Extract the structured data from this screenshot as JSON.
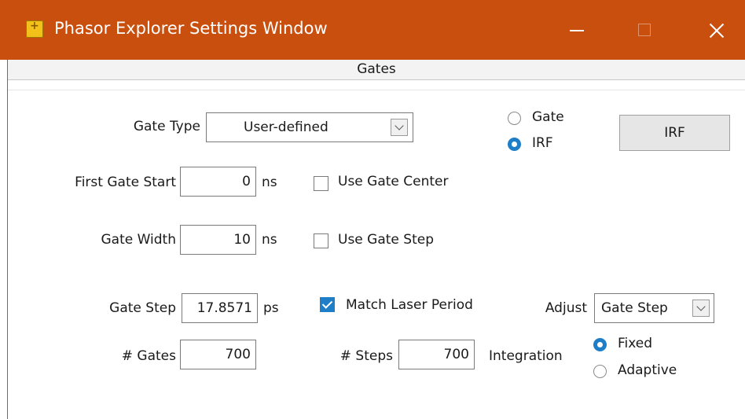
{
  "window": {
    "title": "Phasor Explorer Settings Window",
    "accent_color": "#c94f0f",
    "controls": [
      "minimize-icon",
      "maximize-icon",
      "close-icon"
    ]
  },
  "tabs": [
    {
      "label": "Gates",
      "active": true
    }
  ],
  "gate_type": {
    "label": "Gate Type",
    "value": "User-defined"
  },
  "mode": {
    "options": [
      {
        "label": "Gate",
        "selected": false
      },
      {
        "label": "IRF",
        "selected": true
      }
    ],
    "button_label": "IRF"
  },
  "first_gate_start": {
    "label": "First Gate Start",
    "value": "0",
    "unit": "ns"
  },
  "use_gate_center": {
    "label": "Use Gate Center",
    "checked": false
  },
  "gate_width": {
    "label": "Gate Width",
    "value": "10",
    "unit": "ns"
  },
  "use_gate_step": {
    "label": "Use Gate Step",
    "checked": false
  },
  "gate_step": {
    "label": "Gate Step",
    "value": "17.8571",
    "unit": "ps"
  },
  "match_laser_period": {
    "label": "Match Laser Period",
    "checked": true
  },
  "adjust": {
    "label": "Adjust",
    "value": "Gate Step"
  },
  "num_gates": {
    "label": "# Gates",
    "value": "700"
  },
  "num_steps": {
    "label": "# Steps",
    "value": "700"
  },
  "integration": {
    "label": "Integration",
    "options": [
      {
        "label": "Fixed",
        "selected": true
      },
      {
        "label": "Adaptive",
        "selected": false
      }
    ]
  },
  "colors": {
    "selection_blue": "#1e7fc8"
  }
}
